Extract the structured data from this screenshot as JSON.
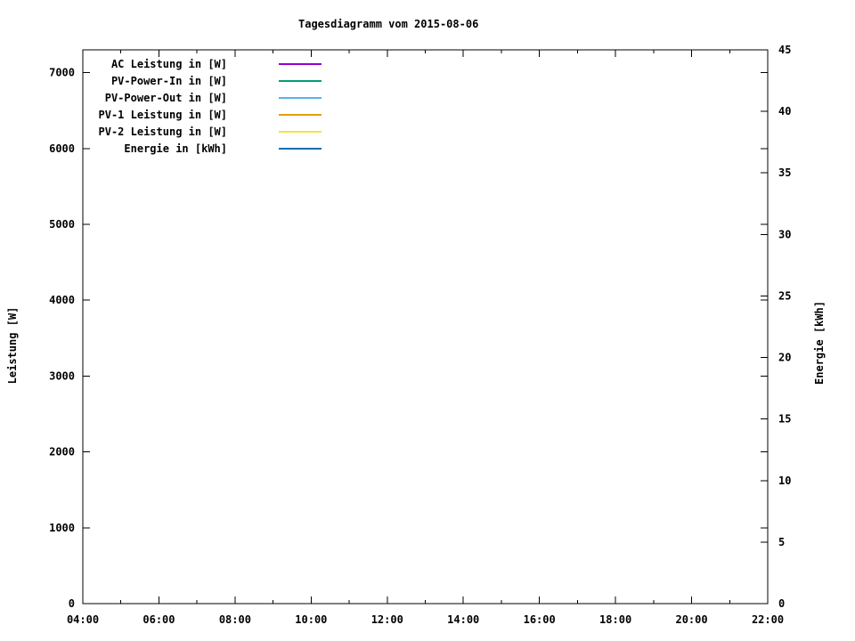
{
  "chart_data": {
    "type": "line",
    "title": "Tagesdiagramm vom 2015-08-06",
    "xlabel": "",
    "ylabel": "Leistung [W]",
    "y2label": "Energie [kWh]",
    "grid": false,
    "legend_position": "top-left-inside",
    "x_axis": {
      "unit": "time",
      "range_hours": [
        4,
        22
      ],
      "major_ticks": [
        {
          "hour": 4,
          "label": "04:00"
        },
        {
          "hour": 6,
          "label": "06:00"
        },
        {
          "hour": 8,
          "label": "08:00"
        },
        {
          "hour": 10,
          "label": "10:00"
        },
        {
          "hour": 12,
          "label": "12:00"
        },
        {
          "hour": 14,
          "label": "14:00"
        },
        {
          "hour": 16,
          "label": "16:00"
        },
        {
          "hour": 18,
          "label": "18:00"
        },
        {
          "hour": 20,
          "label": "20:00"
        },
        {
          "hour": 22,
          "label": "22:00"
        }
      ],
      "minor_tick_hours": [
        5,
        7,
        9,
        11,
        13,
        15,
        17,
        19,
        21
      ]
    },
    "y_axis": {
      "label": "Leistung [W]",
      "range": [
        0,
        7300
      ],
      "tick_values": [
        0,
        1000,
        2000,
        3000,
        4000,
        5000,
        6000,
        7000
      ],
      "tick_labels": [
        "0",
        "1000",
        "2000",
        "3000",
        "4000",
        "5000",
        "6000",
        "7000"
      ],
      "mirrored_on_right": true
    },
    "y2_axis": {
      "label": "Energie [kWh]",
      "range": [
        0,
        45
      ],
      "tick_values": [
        0,
        5,
        10,
        15,
        20,
        25,
        30,
        35,
        40,
        45
      ],
      "tick_labels": [
        "0",
        "5",
        "10",
        "15",
        "20",
        "25",
        "30",
        "35",
        "40",
        "45"
      ]
    },
    "series": [
      {
        "name": "AC Leistung in [W]",
        "color": "#9400d3",
        "axis": "y",
        "values": []
      },
      {
        "name": "PV-Power-In in [W]",
        "color": "#009e73",
        "axis": "y",
        "values": []
      },
      {
        "name": "PV-Power-Out in [W]",
        "color": "#56b4e9",
        "axis": "y",
        "values": []
      },
      {
        "name": "PV-1 Leistung in [W]",
        "color": "#e69f00",
        "axis": "y",
        "values": []
      },
      {
        "name": "PV-2 Leistung in [W]",
        "color": "#f0e442",
        "axis": "y",
        "values": []
      },
      {
        "name": "Energie in [kWh]",
        "color": "#0072b2",
        "axis": "y2",
        "values": []
      }
    ],
    "plot_area_empty": true,
    "colors": {
      "background": "#ffffff",
      "border": "#000000",
      "text": "#000000"
    }
  }
}
